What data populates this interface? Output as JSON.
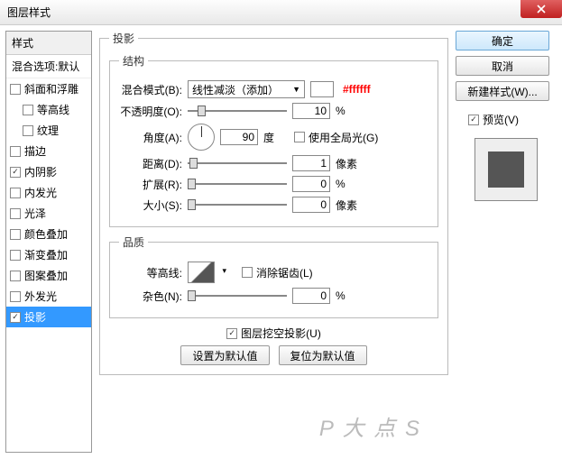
{
  "window": {
    "title": "图层样式"
  },
  "styles_panel": {
    "header": "样式",
    "blend_default": "混合选项:默认",
    "items": [
      {
        "label": "斜面和浮雕",
        "checked": false,
        "indent": false
      },
      {
        "label": "等高线",
        "checked": false,
        "indent": true
      },
      {
        "label": "纹理",
        "checked": false,
        "indent": true
      },
      {
        "label": "描边",
        "checked": false,
        "indent": false
      },
      {
        "label": "内阴影",
        "checked": true,
        "indent": false
      },
      {
        "label": "内发光",
        "checked": false,
        "indent": false
      },
      {
        "label": "光泽",
        "checked": false,
        "indent": false
      },
      {
        "label": "颜色叠加",
        "checked": false,
        "indent": false
      },
      {
        "label": "渐变叠加",
        "checked": false,
        "indent": false
      },
      {
        "label": "图案叠加",
        "checked": false,
        "indent": false
      },
      {
        "label": "外发光",
        "checked": false,
        "indent": false
      },
      {
        "label": "投影",
        "checked": true,
        "indent": false,
        "selected": true
      }
    ]
  },
  "main": {
    "section_title": "投影",
    "structure": {
      "legend": "结构",
      "blend_mode_label": "混合模式(B):",
      "blend_mode_value": "线性减淡（添加）",
      "color_hex": "#ffffff",
      "opacity_label": "不透明度(O):",
      "opacity_value": "10",
      "opacity_unit": "%",
      "angle_label": "角度(A):",
      "angle_value": "90",
      "angle_unit": "度",
      "global_light_label": "使用全局光(G)",
      "global_light_checked": false,
      "distance_label": "距离(D):",
      "distance_value": "1",
      "distance_unit": "像素",
      "spread_label": "扩展(R):",
      "spread_value": "0",
      "spread_unit": "%",
      "size_label": "大小(S):",
      "size_value": "0",
      "size_unit": "像素"
    },
    "quality": {
      "legend": "品质",
      "contour_label": "等高线:",
      "antialias_label": "消除锯齿(L)",
      "antialias_checked": false,
      "noise_label": "杂色(N):",
      "noise_value": "0",
      "noise_unit": "%"
    },
    "knockout": {
      "label": "图层挖空投影(U)",
      "checked": true
    },
    "reset": {
      "make_default": "设置为默认值",
      "reset_default": "复位为默认值"
    }
  },
  "buttons": {
    "ok": "确定",
    "cancel": "取消",
    "new_style": "新建样式(W)...",
    "preview_label": "预览(V)",
    "preview_checked": true
  },
  "watermark": "P 大 点 S"
}
